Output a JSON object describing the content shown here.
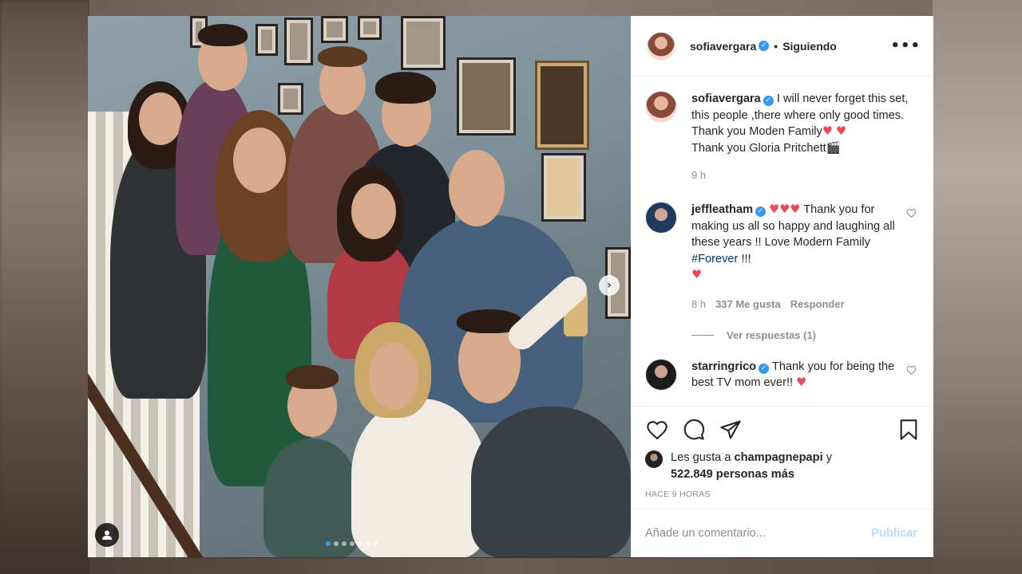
{
  "post": {
    "author": "sofiavergara",
    "follow_state": "Siguiendo",
    "more_glyph": "•••",
    "separator": "•"
  },
  "caption": {
    "username": "sofiavergara",
    "text_1": "I will never forget this set, this people ,there where only good times. Thank you Moden Family",
    "text_2": "Thank you Gloria Pritchett",
    "clapper_emoji": "🎬",
    "time": "9 h"
  },
  "comments": [
    {
      "username": "jeffleatham",
      "text_1": "Thank you for making us all so happy and laughing all these years !! Love Modern Family",
      "hashtag": "#Forever",
      "text_2": "!!!",
      "time": "8 h",
      "likes": "337 Me gusta",
      "reply": "Responder",
      "view_replies": "Ver respuestas (1)"
    },
    {
      "username": "starringrico",
      "text_1": "Thank you for being the best TV mom ever!!"
    }
  ],
  "likes": {
    "prefix": "Les gusta a",
    "user": "champagnepapi",
    "connector": "y",
    "count": "522.849 personas más"
  },
  "timestamp": "HACE 9 HORAS",
  "comment_input": {
    "placeholder": "Añade un comentario...",
    "submit": "Publicar"
  },
  "carousel": {
    "total": 7,
    "active": 0,
    "next_glyph": "›"
  },
  "icons": {
    "heart": "♥",
    "verified": "✓"
  },
  "colors": {
    "verified": "#3897f0",
    "heart": "#ed4956",
    "link": "#00376b",
    "publish_disabled": "#b2dffc"
  }
}
